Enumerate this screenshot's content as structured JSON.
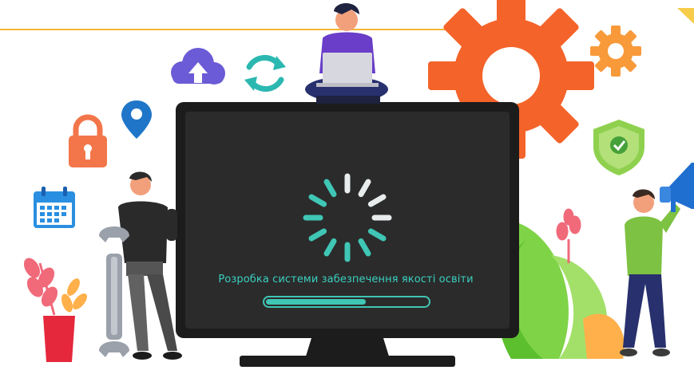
{
  "screen": {
    "caption": "Розробка системи забезпечення якості освіти",
    "progress": 0.62
  },
  "colors": {
    "frame_yellow": "#f2b533",
    "monitor": "#2b2b2b",
    "monitor_edge": "#1c1c1c",
    "spinner": "#3fc6b5",
    "spinner_light": "#e8ecec",
    "gear_orange": "#f4632a",
    "gear_light": "#f89a3a",
    "cloud_purple": "#6c5bd6",
    "sync_teal": "#2bb8b0",
    "pin_blue": "#1f76c8",
    "lock_orange": "#f2764a",
    "shield_green": "#8fd14f",
    "plant_green": "#7fd347",
    "plant_pink": "#f06a7a",
    "pot_red": "#e5283c",
    "shirt_purple": "#6a3ec8",
    "shirt_green": "#7dc242",
    "pants_navy": "#28306e"
  },
  "icons": [
    "cloud-upload-icon",
    "sync-icon",
    "location-pin-icon",
    "padlock-icon",
    "calendar-icon",
    "gear-icon",
    "shield-check-icon",
    "megaphone-icon",
    "wrench-icon",
    "loading-spinner-icon"
  ]
}
